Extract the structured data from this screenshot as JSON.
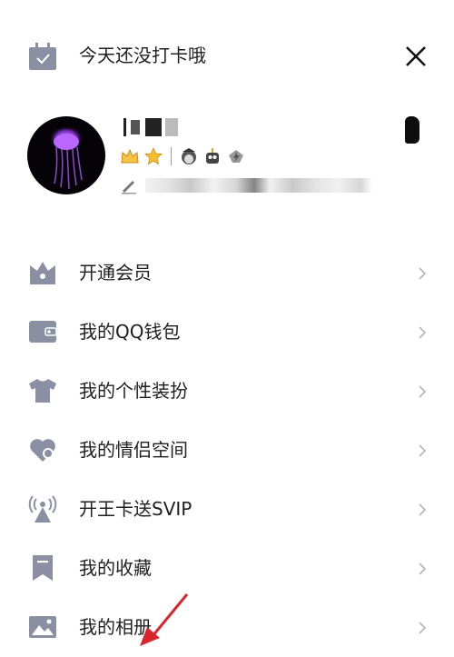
{
  "header": {
    "checkin_text": "今天还没打卡哦",
    "checkin_icon": "calendar-check-icon",
    "close_icon": "close-icon"
  },
  "profile": {
    "avatar_icon": "jellyfish-avatar",
    "badges": [
      "crown-badge-icon",
      "star-badge-icon",
      "penguin-badge-icon",
      "robot-badge-icon",
      "lightning-badge-icon"
    ],
    "edit_icon": "pencil-icon"
  },
  "menu": {
    "items": [
      {
        "label": "开通会员",
        "icon": "crown-icon"
      },
      {
        "label": "我的QQ钱包",
        "icon": "wallet-icon"
      },
      {
        "label": "我的个性装扮",
        "icon": "tshirt-icon"
      },
      {
        "label": "我的情侣空间",
        "icon": "heart-icon"
      },
      {
        "label": "开王卡送SVIP",
        "icon": "signal-tower-icon"
      },
      {
        "label": "我的收藏",
        "icon": "bookmark-icon"
      },
      {
        "label": "我的相册",
        "icon": "photo-icon"
      }
    ]
  },
  "colors": {
    "icon_gray": "#8a8fa3",
    "text": "#1f1f1f",
    "chevron": "#b5b5b5",
    "arrow_red": "#d9262a"
  }
}
